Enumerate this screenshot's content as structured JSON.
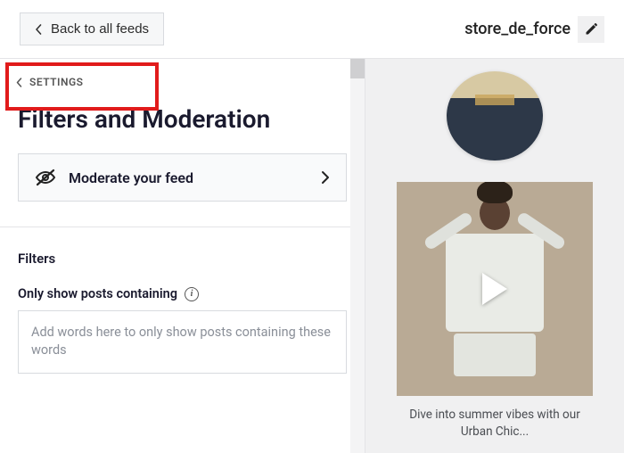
{
  "topbar": {
    "back_label": "Back to all feeds",
    "feed_name": "store_de_force"
  },
  "breadcrumb": {
    "label": "SETTINGS"
  },
  "page": {
    "title": "Filters and Moderation"
  },
  "moderate": {
    "label": "Moderate your feed"
  },
  "filters": {
    "section_label": "Filters",
    "only_show_label": "Only show posts containing",
    "only_show_placeholder": "Add words here to only show posts containing these words"
  },
  "preview": {
    "caption": "Dive into summer vibes with our Urban Chic..."
  }
}
